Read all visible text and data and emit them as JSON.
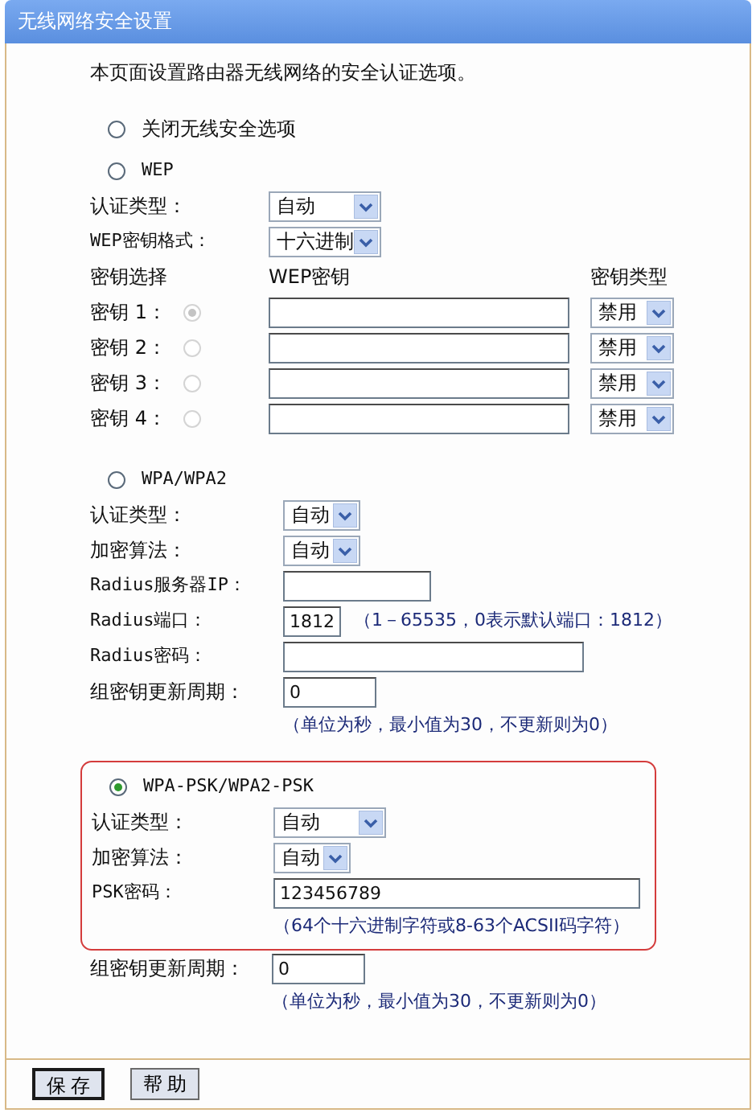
{
  "title": "无线网络安全设置",
  "intro": "本页面设置路由器无线网络的安全认证选项。",
  "modes": [
    {
      "kind": "off",
      "label": "关闭无线安全选项",
      "selected": false
    },
    {
      "kind": "wep",
      "label": "WEP",
      "selected": false,
      "fields": [
        {
          "kind": "select",
          "label": "认证类型：",
          "value": "自动"
        },
        {
          "kind": "select",
          "label": "WEP密钥格式：",
          "value": "十六进制"
        }
      ],
      "key_columns": [
        "密钥选择",
        "WEP密钥",
        "密钥类型"
      ],
      "keys": [
        {
          "label": "密钥 1：",
          "selected": true,
          "type": "禁用"
        },
        {
          "label": "密钥 2：",
          "selected": false,
          "type": "禁用"
        },
        {
          "label": "密钥 3：",
          "selected": false,
          "type": "禁用"
        },
        {
          "label": "密钥 4：",
          "selected": false,
          "type": "禁用"
        }
      ]
    },
    {
      "kind": "wpa",
      "label": "WPA/WPA2",
      "selected": false,
      "fields": [
        {
          "kind": "select-narrow",
          "label": "认证类型：",
          "value": "自动"
        },
        {
          "kind": "select-narrow",
          "label": "加密算法：",
          "value": "自动"
        },
        {
          "kind": "text-medium",
          "label": "Radius服务器IP："
        },
        {
          "kind": "text-short",
          "label": "Radius端口：",
          "value": "1812",
          "hint": "（1－65535，0表示默认端口：1812）"
        },
        {
          "kind": "text-long",
          "label": "Radius密码："
        },
        {
          "kind": "text-small",
          "label": "组密钥更新周期：",
          "value": "0",
          "note": "（单位为秒，最小值为30，不更新则为0）"
        }
      ]
    },
    {
      "kind": "psk",
      "label": "WPA-PSK/WPA2-PSK",
      "selected": true,
      "highlighted": true,
      "fields": [
        {
          "kind": "select",
          "label": "认证类型：",
          "value": "自动"
        },
        {
          "kind": "select-narrow",
          "label": "加密算法：",
          "value": "自动"
        },
        {
          "kind": "text-wide",
          "label": "PSK密码：",
          "value": "123456789",
          "note": "（64个十六进制字符或8-63个ACSII码字符）"
        }
      ],
      "after": [
        {
          "kind": "text-small",
          "label": "组密钥更新周期：",
          "value": "0",
          "note": "（单位为秒，最小值为30，不更新则为0）"
        }
      ]
    }
  ],
  "buttons": [
    {
      "label": "保存",
      "focused": true
    },
    {
      "label": "帮助",
      "focused": false
    }
  ]
}
